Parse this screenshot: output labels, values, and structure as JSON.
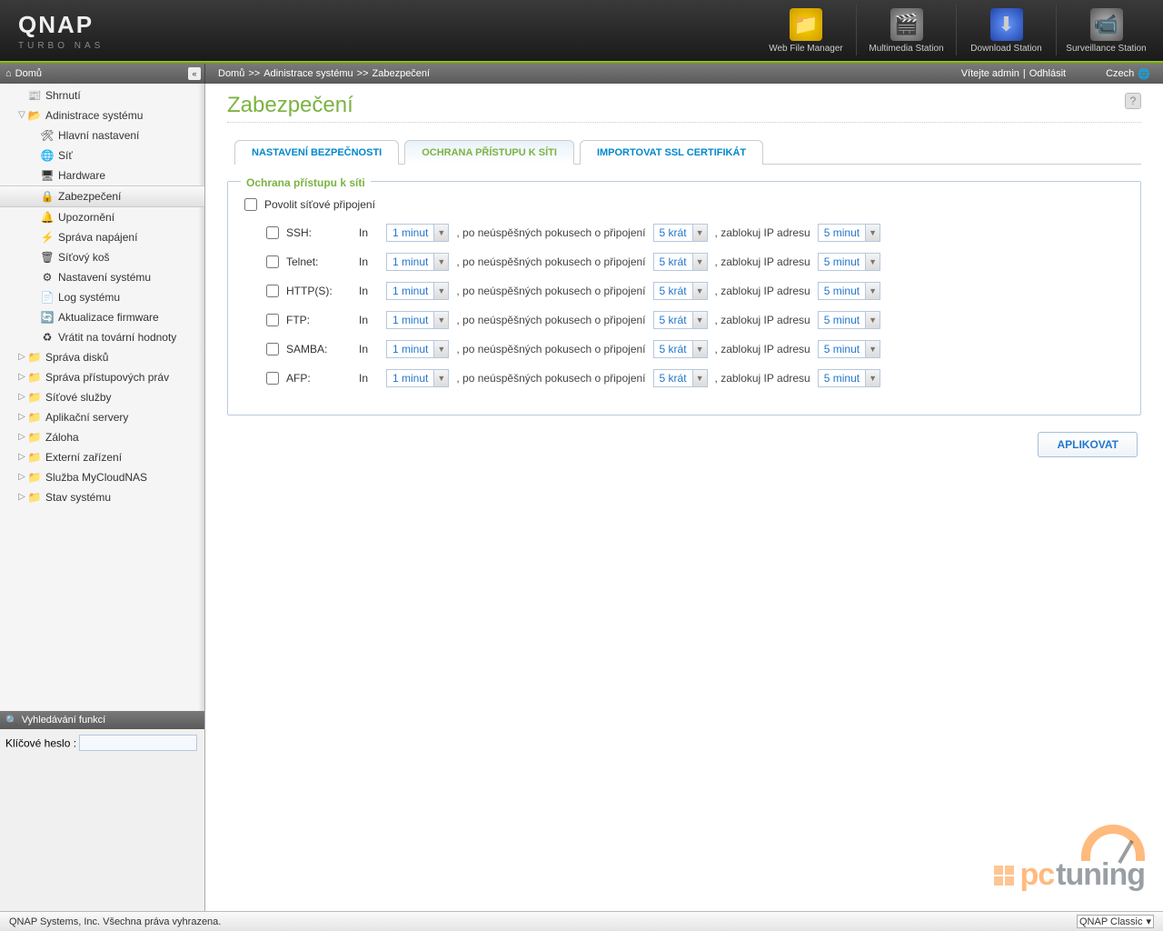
{
  "header": {
    "logo": "QNAP",
    "sub": "TURBO NAS",
    "apps": [
      {
        "label": "Web File Manager",
        "cls": "wfm",
        "glyph": "📁"
      },
      {
        "label": "Multimedia Station",
        "cls": "ms",
        "glyph": "🎬"
      },
      {
        "label": "Download Station",
        "cls": "ds",
        "glyph": "⬇"
      },
      {
        "label": "Surveillance Station",
        "cls": "ss",
        "glyph": "📹"
      }
    ]
  },
  "topbar": {
    "home": "Domů",
    "breadcrumb": [
      "Domů",
      "Adinistrace systému",
      "Zabezpečení"
    ],
    "welcome": "Vítejte admin",
    "logout": "Odhlásit",
    "language": "Czech"
  },
  "sidebar": {
    "items": [
      {
        "label": "Shrnutí",
        "icon": "📰",
        "indent": 1,
        "arrow": ""
      },
      {
        "label": "Adinistrace systému",
        "icon": "📂",
        "indent": 1,
        "arrow": "▽",
        "open": true
      },
      {
        "label": "Hlavní nastavení",
        "icon": "🛠",
        "indent": 2
      },
      {
        "label": "Síť",
        "icon": "🌐",
        "indent": 2
      },
      {
        "label": "Hardware",
        "icon": "🖥",
        "indent": 2
      },
      {
        "label": "Zabezpečení",
        "icon": "🔒",
        "indent": 2,
        "selected": true
      },
      {
        "label": "Upozornění",
        "icon": "🔔",
        "indent": 2
      },
      {
        "label": "Správa napájení",
        "icon": "⚡",
        "indent": 2
      },
      {
        "label": "Síťový koš",
        "icon": "🗑",
        "indent": 2
      },
      {
        "label": "Nastavení systému",
        "icon": "⚙",
        "indent": 2
      },
      {
        "label": "Log systému",
        "icon": "📄",
        "indent": 2
      },
      {
        "label": "Aktualizace firmware",
        "icon": "🔄",
        "indent": 2
      },
      {
        "label": "Vrátit na tovární hodnoty",
        "icon": "♻",
        "indent": 2
      },
      {
        "label": "Správa disků",
        "icon": "📁",
        "indent": 1,
        "arrow": "▷"
      },
      {
        "label": "Správa přístupových práv",
        "icon": "📁",
        "indent": 1,
        "arrow": "▷"
      },
      {
        "label": "Síťové služby",
        "icon": "📁",
        "indent": 1,
        "arrow": "▷"
      },
      {
        "label": "Aplikační servery",
        "icon": "📁",
        "indent": 1,
        "arrow": "▷"
      },
      {
        "label": "Záloha",
        "icon": "📁",
        "indent": 1,
        "arrow": "▷"
      },
      {
        "label": "Externí zařízení",
        "icon": "📁",
        "indent": 1,
        "arrow": "▷"
      },
      {
        "label": "Služba MyCloudNAS",
        "icon": "📁",
        "indent": 1,
        "arrow": "▷"
      },
      {
        "label": "Stav systému",
        "icon": "📁",
        "indent": 1,
        "arrow": "▷"
      }
    ]
  },
  "search": {
    "title": "Vyhledávání funkcí",
    "keyword_label": "Klíčové heslo :"
  },
  "page": {
    "title": "Zabezpečení",
    "tabs": [
      {
        "label": "NASTAVENÍ BEZPEČNOSTI",
        "active": false
      },
      {
        "label": "OCHRANA PŘÍSTUPU K SÍTI",
        "active": true
      },
      {
        "label": "IMPORTOVAT SSL CERTIFIKÁT",
        "active": false
      }
    ],
    "fieldset_legend": "Ochrana přístupu k síti",
    "enable_label": "Povolit síťové připojení",
    "in_label": "In",
    "after_label": ", po neúspěšných pokusech o připojení",
    "block_label": ", zablokuj IP adresu",
    "time_value": "1 minut",
    "count_value": "5 krát",
    "block_value": "5 minut",
    "protocols": [
      "SSH:",
      "Telnet:",
      "HTTP(S):",
      "FTP:",
      "SAMBA:",
      "AFP:"
    ],
    "apply": "APLIKOVAT"
  },
  "footer": {
    "copyright": "QNAP Systems, Inc. Všechna práva vyhrazena.",
    "theme": "QNAP Classic"
  }
}
